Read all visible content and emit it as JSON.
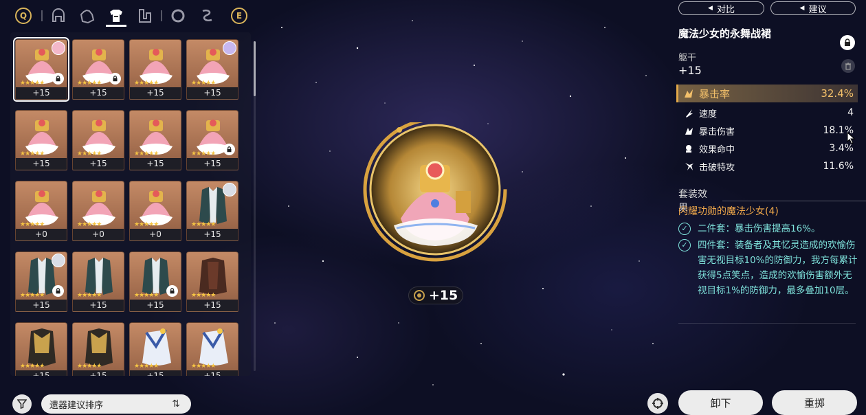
{
  "tabs": {
    "left_key": "Q",
    "right_key": "E",
    "items": [
      {
        "name": "head-tab",
        "icon": "helmet-icon"
      },
      {
        "name": "hands-tab",
        "icon": "glove-icon"
      },
      {
        "name": "body-tab",
        "icon": "armor-icon",
        "active": true
      },
      {
        "name": "feet-tab",
        "icon": "boots-icon"
      },
      {
        "name": "sphere-tab",
        "icon": "ring-icon"
      },
      {
        "name": "rope-tab",
        "icon": "rope-icon"
      }
    ]
  },
  "inventory": {
    "items": [
      {
        "level": "+15",
        "type": "dress",
        "locked": true,
        "avatar": "pink",
        "selected": true
      },
      {
        "level": "+15",
        "type": "dress",
        "locked": true
      },
      {
        "level": "+15",
        "type": "dress"
      },
      {
        "level": "+15",
        "type": "dress",
        "avatar": "lilac"
      },
      {
        "level": "+15",
        "type": "dress"
      },
      {
        "level": "+15",
        "type": "dress"
      },
      {
        "level": "+15",
        "type": "dress"
      },
      {
        "level": "+15",
        "type": "dress",
        "locked": true
      },
      {
        "level": "+0",
        "type": "dress"
      },
      {
        "level": "+0",
        "type": "dress"
      },
      {
        "level": "+0",
        "type": "dress"
      },
      {
        "level": "+15",
        "type": "coat",
        "avatar": "silver"
      },
      {
        "level": "+15",
        "type": "coat",
        "locked": true,
        "avatar": "silver"
      },
      {
        "level": "+15",
        "type": "coat"
      },
      {
        "level": "+15",
        "type": "coat",
        "locked": true
      },
      {
        "level": "+15",
        "type": "brown"
      },
      {
        "level": "+15",
        "type": "gold"
      },
      {
        "level": "+15",
        "type": "gold"
      },
      {
        "level": "+15",
        "type": "cape"
      },
      {
        "level": "+15",
        "type": "cape"
      }
    ],
    "stars": "★★★★★"
  },
  "sort": {
    "label": "遗器建议排序",
    "filter_icon": "filter-icon",
    "order_icon": "sort-order-icon"
  },
  "center": {
    "level": "+15"
  },
  "detail": {
    "compare_label": "对比",
    "suggest_label": "建议",
    "relic_name": "魔法少女的永舞战裙",
    "slot_name": "躯干",
    "level": "+15",
    "main_stat": {
      "label": "暴击率",
      "value": "32.4%",
      "icon": "crit-rate-icon"
    },
    "sub_stats": [
      {
        "label": "速度",
        "value": "4",
        "icon": "speed-icon"
      },
      {
        "label": "暴击伤害",
        "value": "18.1%",
        "icon": "crit-dmg-icon"
      },
      {
        "label": "效果命中",
        "value": "3.4%",
        "icon": "effect-hit-icon"
      },
      {
        "label": "击破特攻",
        "value": "11.6%",
        "icon": "break-effect-icon"
      }
    ],
    "set_header": "套装效果",
    "set_name": "闪耀功勋的魔法少女(4)",
    "set_effects": [
      "二件套：暴击伤害提高16%。",
      "四件套：装备者及其忆灵造成的欢愉伤害无视目标10%的防御力，我方每累计获得5点笑点，造成的欢愉伤害额外无视目标1%的防御力，最多叠加10层。"
    ]
  },
  "actions": {
    "unequip_label": "卸下",
    "reforge_label": "重掷"
  },
  "colors": {
    "accent_gold": "#e2a849",
    "set_green": "#7fe3dc",
    "tile_bronze": "#c48a66"
  }
}
